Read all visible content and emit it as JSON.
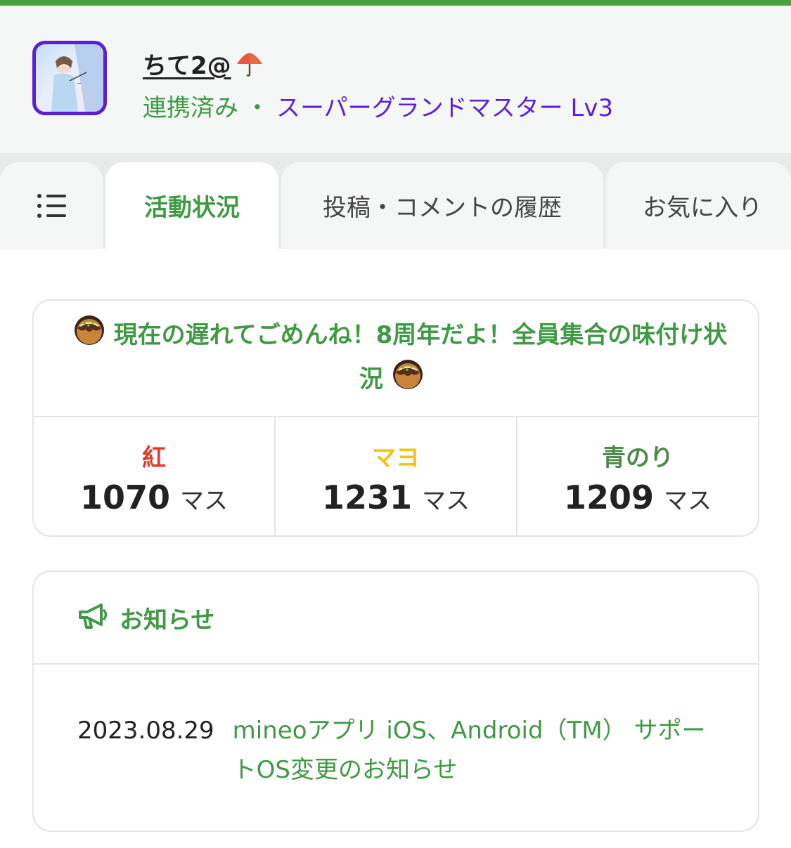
{
  "profile": {
    "username": "ちて2@",
    "status": "連携済み",
    "separator": "・",
    "rank": "スーパーグランドマスター Lv3"
  },
  "tabs": [
    {
      "label": "",
      "icon": "list-icon"
    },
    {
      "label": "活動状況",
      "active": true
    },
    {
      "label": "投稿・コメントの履歴"
    },
    {
      "label": "お気に入り"
    }
  ],
  "event": {
    "title": "現在の遅れてごめんね！8周年だよ！全員集合の味付け状況",
    "icon": "takoyaki-icon",
    "stats": [
      {
        "name": "紅",
        "value": "1070",
        "unit": "マス",
        "color": "#e23b2e"
      },
      {
        "name": "マヨ",
        "value": "1231",
        "unit": "マス",
        "color": "#f0c419"
      },
      {
        "name": "青のり",
        "value": "1209",
        "unit": "マス",
        "color": "#4f8a4a"
      }
    ]
  },
  "news": {
    "title": "お知らせ",
    "icon": "megaphone-icon",
    "items": [
      {
        "date": "2023.08.29",
        "text": "mineoアプリ iOS、Android（TM） サポートOS変更のお知らせ"
      }
    ]
  },
  "colors": {
    "accent": "#3f9a43",
    "rank": "#5b1fd6",
    "topbar": "#46a33e"
  }
}
